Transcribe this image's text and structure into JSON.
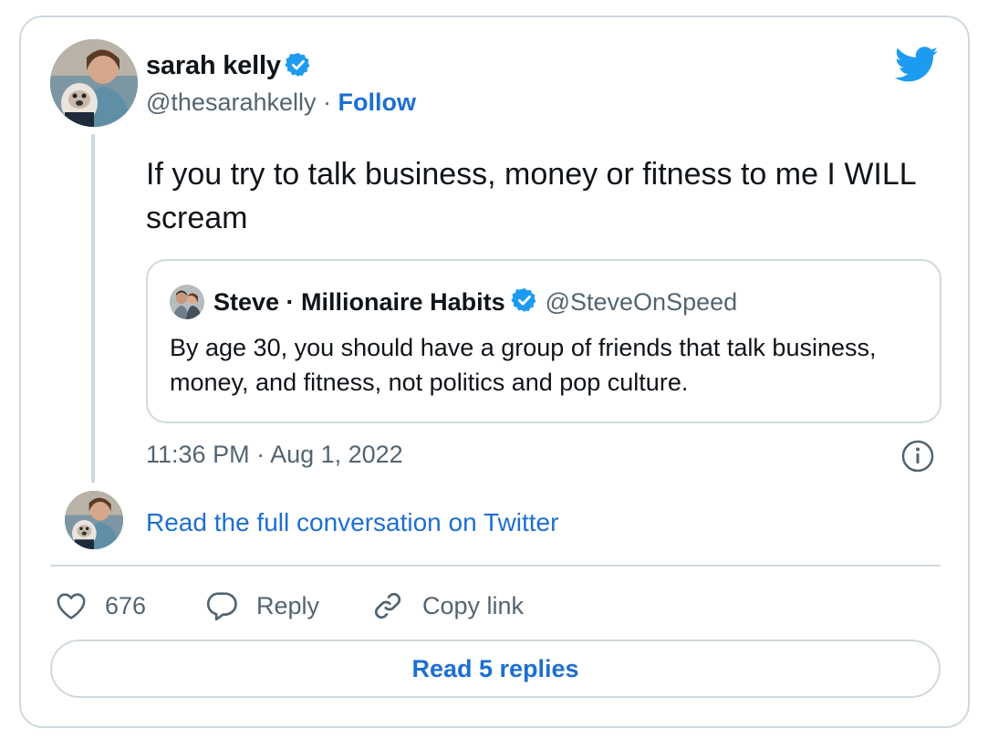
{
  "author": {
    "name": "sarah kelly",
    "handle": "@thesarahkelly",
    "separator": "·",
    "follow_label": "Follow"
  },
  "tweet": {
    "text": "If you try to talk business, money or fitness to me I WILL scream",
    "timestamp": "11:36 PM · Aug 1, 2022"
  },
  "quote": {
    "name": "Steve · Millionaire Habits",
    "handle": "@SteveOnSpeed",
    "text": "By age 30, you should have a group of friends that talk business, money, and fitness, not politics and pop culture."
  },
  "conversation": {
    "link_label": "Read the full conversation on Twitter"
  },
  "actions": {
    "likes_count": "676",
    "reply_label": "Reply",
    "copy_link_label": "Copy link"
  },
  "replies_button": {
    "label": "Read 5 replies"
  },
  "icons": {
    "brand": "twitter-bird-icon",
    "verified": "verified-badge-icon",
    "info": "info-icon",
    "like": "heart-icon",
    "reply": "reply-bubble-icon",
    "link": "link-icon"
  },
  "colors": {
    "link_blue": "#1d6fd1",
    "twitter_blue": "#1d9bf0",
    "secondary_text": "#536471",
    "border": "#cfd9de"
  }
}
